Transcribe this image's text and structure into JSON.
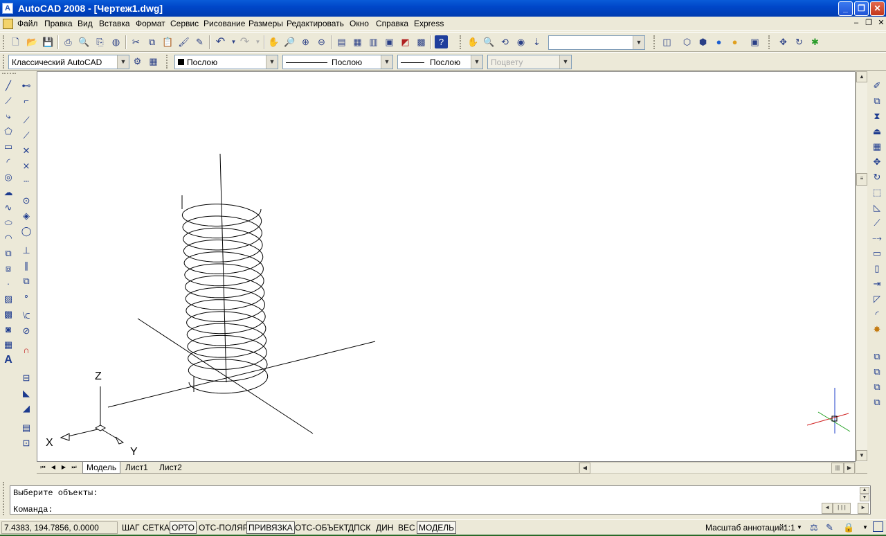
{
  "window": {
    "title": "AutoCAD 2008 - [Чертеж1.dwg]"
  },
  "menu": [
    "Файл",
    "Правка",
    "Вид",
    "Вставка",
    "Формат",
    "Сервис",
    "Рисование",
    "Размеры",
    "Редактировать",
    "Окно",
    "Справка",
    "Express"
  ],
  "toolbar2": {
    "workspace": "Классический AutoCAD",
    "color": "Послою",
    "linetype": "Послою",
    "lineweight": "Послою",
    "plotstyle": "Поцвету"
  },
  "ucs": {
    "x": "X",
    "y": "Y",
    "z": "Z"
  },
  "tabs": [
    "Модель",
    "Лист1",
    "Лист2"
  ],
  "command": {
    "line1": "Выберите объекты:",
    "line2": "Команда:"
  },
  "status": {
    "coords": "7.4383, 194.7856, 0.0000",
    "toggles": [
      "ШАГ",
      "СЕТКА",
      "ОРТО",
      "ОТС-ПОЛЯР",
      "ПРИВЯЗКА",
      "ОТС-ОБЪЕКТ",
      "ДПСК",
      "ДИН",
      "ВЕС",
      "МОДЕЛЬ"
    ],
    "annotation_label": "Масштаб аннотаций:",
    "annotation_scale": "1:1"
  },
  "icons": {
    "draw": [
      "line-icon",
      "construction-line-icon",
      "polyline-icon",
      "polygon-icon",
      "rectangle-icon",
      "arc-icon",
      "circle-icon",
      "revcloud-icon",
      "spline-icon",
      "ellipse-icon",
      "ellipse-arc-icon",
      "insert-block-icon",
      "make-block-icon",
      "point-icon",
      "hatch-icon",
      "gradient-icon",
      "region-icon",
      "table-icon",
      "mtext-icon"
    ],
    "modify": [
      "erase-icon",
      "copy-icon",
      "mirror-icon",
      "offset-icon",
      "array-icon",
      "move-icon",
      "rotate-icon",
      "scale-icon",
      "stretch-icon",
      "trim-icon",
      "extend-icon",
      "break-at-point-icon",
      "break-icon",
      "join-icon",
      "chamfer-icon",
      "fillet-icon",
      "explode-icon"
    ]
  }
}
